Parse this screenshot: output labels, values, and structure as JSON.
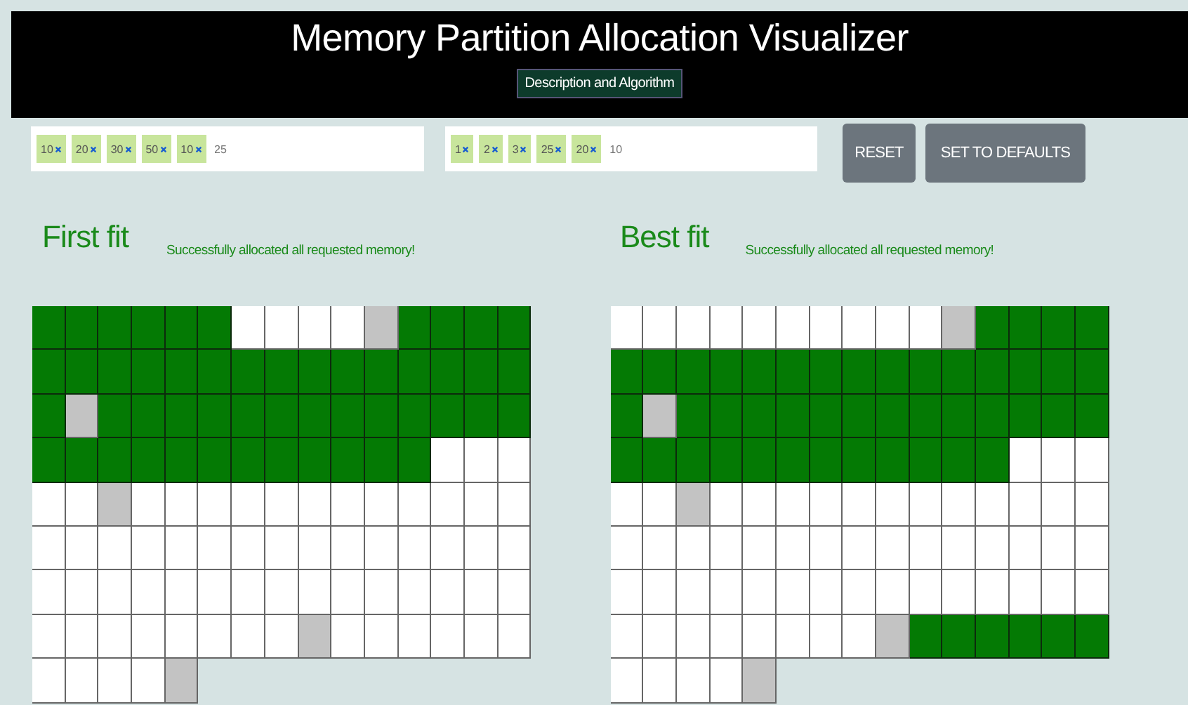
{
  "header": {
    "title": "Memory Partition Allocation Visualizer",
    "link_button": "Description and Algorithm"
  },
  "inputs": [
    {
      "tags": [
        {
          "label": "10"
        },
        {
          "label": "20"
        },
        {
          "label": "30"
        },
        {
          "label": "50"
        },
        {
          "label": "10"
        }
      ],
      "value": "25"
    },
    {
      "tags": [
        {
          "label": "1"
        },
        {
          "label": "2"
        },
        {
          "label": "3"
        },
        {
          "label": "25"
        },
        {
          "label": "20"
        }
      ],
      "value": "10"
    }
  ],
  "buttons": [
    "RESET",
    "SET TO DEFAULTS"
  ],
  "panels": [
    {
      "title": "First fit",
      "message": "Successfully allocated all requested memory!",
      "grid": [
        [
          {
            "kind": "used"
          },
          {
            "kind": "used"
          },
          {
            "kind": "used"
          },
          {
            "kind": "used"
          },
          {
            "kind": "used"
          },
          {
            "kind": "used"
          },
          {
            "kind": "free"
          },
          {
            "kind": "free"
          },
          {
            "kind": "free"
          },
          {
            "kind": "free"
          },
          {
            "kind": "boundary"
          },
          {
            "kind": "used"
          },
          {
            "kind": "used"
          },
          {
            "kind": "used"
          },
          {
            "kind": "used"
          }
        ],
        [
          {
            "kind": "used"
          },
          {
            "kind": "used"
          },
          {
            "kind": "used"
          },
          {
            "kind": "used"
          },
          {
            "kind": "used"
          },
          {
            "kind": "used"
          },
          {
            "kind": "used"
          },
          {
            "kind": "used"
          },
          {
            "kind": "used"
          },
          {
            "kind": "used"
          },
          {
            "kind": "used"
          },
          {
            "kind": "used"
          },
          {
            "kind": "used"
          },
          {
            "kind": "used"
          },
          {
            "kind": "used"
          }
        ],
        [
          {
            "kind": "used"
          },
          {
            "kind": "boundary"
          },
          {
            "kind": "used"
          },
          {
            "kind": "used"
          },
          {
            "kind": "used"
          },
          {
            "kind": "used"
          },
          {
            "kind": "used"
          },
          {
            "kind": "used"
          },
          {
            "kind": "used"
          },
          {
            "kind": "used"
          },
          {
            "kind": "used"
          },
          {
            "kind": "used"
          },
          {
            "kind": "used"
          },
          {
            "kind": "used"
          },
          {
            "kind": "used"
          }
        ],
        [
          {
            "kind": "used"
          },
          {
            "kind": "used"
          },
          {
            "kind": "used"
          },
          {
            "kind": "used"
          },
          {
            "kind": "used"
          },
          {
            "kind": "used"
          },
          {
            "kind": "used"
          },
          {
            "kind": "used"
          },
          {
            "kind": "used"
          },
          {
            "kind": "used"
          },
          {
            "kind": "used"
          },
          {
            "kind": "used"
          },
          {
            "kind": "free"
          },
          {
            "kind": "free"
          },
          {
            "kind": "free"
          }
        ],
        [
          {
            "kind": "free"
          },
          {
            "kind": "free"
          },
          {
            "kind": "boundary"
          },
          {
            "kind": "free"
          },
          {
            "kind": "free"
          },
          {
            "kind": "free"
          },
          {
            "kind": "free"
          },
          {
            "kind": "free"
          },
          {
            "kind": "free"
          },
          {
            "kind": "free"
          },
          {
            "kind": "free"
          },
          {
            "kind": "free"
          },
          {
            "kind": "free"
          },
          {
            "kind": "free"
          },
          {
            "kind": "free"
          }
        ],
        [
          {
            "kind": "free"
          },
          {
            "kind": "free"
          },
          {
            "kind": "free"
          },
          {
            "kind": "free"
          },
          {
            "kind": "free"
          },
          {
            "kind": "free"
          },
          {
            "kind": "free"
          },
          {
            "kind": "free"
          },
          {
            "kind": "free"
          },
          {
            "kind": "free"
          },
          {
            "kind": "free"
          },
          {
            "kind": "free"
          },
          {
            "kind": "free"
          },
          {
            "kind": "free"
          },
          {
            "kind": "free"
          }
        ],
        [
          {
            "kind": "free"
          },
          {
            "kind": "free"
          },
          {
            "kind": "free"
          },
          {
            "kind": "free"
          },
          {
            "kind": "free"
          },
          {
            "kind": "free"
          },
          {
            "kind": "free"
          },
          {
            "kind": "free"
          },
          {
            "kind": "free"
          },
          {
            "kind": "free"
          },
          {
            "kind": "free"
          },
          {
            "kind": "free"
          },
          {
            "kind": "free"
          },
          {
            "kind": "free"
          },
          {
            "kind": "free"
          }
        ],
        [
          {
            "kind": "free"
          },
          {
            "kind": "free"
          },
          {
            "kind": "free"
          },
          {
            "kind": "free"
          },
          {
            "kind": "free"
          },
          {
            "kind": "free"
          },
          {
            "kind": "free"
          },
          {
            "kind": "free"
          },
          {
            "kind": "boundary"
          },
          {
            "kind": "free"
          },
          {
            "kind": "free"
          },
          {
            "kind": "free"
          },
          {
            "kind": "free"
          },
          {
            "kind": "free"
          },
          {
            "kind": "free"
          }
        ],
        [
          {
            "kind": "free"
          },
          {
            "kind": "free"
          },
          {
            "kind": "free"
          },
          {
            "kind": "free"
          },
          {
            "kind": "boundary"
          }
        ]
      ]
    },
    {
      "title": "Best fit",
      "message": "Successfully allocated all requested memory!",
      "grid": [
        [
          {
            "kind": "free"
          },
          {
            "kind": "free"
          },
          {
            "kind": "free"
          },
          {
            "kind": "free"
          },
          {
            "kind": "free"
          },
          {
            "kind": "free"
          },
          {
            "kind": "free"
          },
          {
            "kind": "free"
          },
          {
            "kind": "free"
          },
          {
            "kind": "free"
          },
          {
            "kind": "boundary"
          },
          {
            "kind": "used"
          },
          {
            "kind": "used"
          },
          {
            "kind": "used"
          },
          {
            "kind": "used"
          }
        ],
        [
          {
            "kind": "used"
          },
          {
            "kind": "used"
          },
          {
            "kind": "used"
          },
          {
            "kind": "used"
          },
          {
            "kind": "used"
          },
          {
            "kind": "used"
          },
          {
            "kind": "used"
          },
          {
            "kind": "used"
          },
          {
            "kind": "used"
          },
          {
            "kind": "used"
          },
          {
            "kind": "used"
          },
          {
            "kind": "used"
          },
          {
            "kind": "used"
          },
          {
            "kind": "used"
          },
          {
            "kind": "used"
          }
        ],
        [
          {
            "kind": "used"
          },
          {
            "kind": "boundary"
          },
          {
            "kind": "used"
          },
          {
            "kind": "used"
          },
          {
            "kind": "used"
          },
          {
            "kind": "used"
          },
          {
            "kind": "used"
          },
          {
            "kind": "used"
          },
          {
            "kind": "used"
          },
          {
            "kind": "used"
          },
          {
            "kind": "used"
          },
          {
            "kind": "used"
          },
          {
            "kind": "used"
          },
          {
            "kind": "used"
          },
          {
            "kind": "used"
          }
        ],
        [
          {
            "kind": "used"
          },
          {
            "kind": "used"
          },
          {
            "kind": "used"
          },
          {
            "kind": "used"
          },
          {
            "kind": "used"
          },
          {
            "kind": "used"
          },
          {
            "kind": "used"
          },
          {
            "kind": "used"
          },
          {
            "kind": "used"
          },
          {
            "kind": "used"
          },
          {
            "kind": "used"
          },
          {
            "kind": "used"
          },
          {
            "kind": "free"
          },
          {
            "kind": "free"
          },
          {
            "kind": "free"
          }
        ],
        [
          {
            "kind": "free"
          },
          {
            "kind": "free"
          },
          {
            "kind": "boundary"
          },
          {
            "kind": "free"
          },
          {
            "kind": "free"
          },
          {
            "kind": "free"
          },
          {
            "kind": "free"
          },
          {
            "kind": "free"
          },
          {
            "kind": "free"
          },
          {
            "kind": "free"
          },
          {
            "kind": "free"
          },
          {
            "kind": "free"
          },
          {
            "kind": "free"
          },
          {
            "kind": "free"
          },
          {
            "kind": "free"
          }
        ],
        [
          {
            "kind": "free"
          },
          {
            "kind": "free"
          },
          {
            "kind": "free"
          },
          {
            "kind": "free"
          },
          {
            "kind": "free"
          },
          {
            "kind": "free"
          },
          {
            "kind": "free"
          },
          {
            "kind": "free"
          },
          {
            "kind": "free"
          },
          {
            "kind": "free"
          },
          {
            "kind": "free"
          },
          {
            "kind": "free"
          },
          {
            "kind": "free"
          },
          {
            "kind": "free"
          },
          {
            "kind": "free"
          }
        ],
        [
          {
            "kind": "free"
          },
          {
            "kind": "free"
          },
          {
            "kind": "free"
          },
          {
            "kind": "free"
          },
          {
            "kind": "free"
          },
          {
            "kind": "free"
          },
          {
            "kind": "free"
          },
          {
            "kind": "free"
          },
          {
            "kind": "free"
          },
          {
            "kind": "free"
          },
          {
            "kind": "free"
          },
          {
            "kind": "free"
          },
          {
            "kind": "free"
          },
          {
            "kind": "free"
          },
          {
            "kind": "free"
          }
        ],
        [
          {
            "kind": "free"
          },
          {
            "kind": "free"
          },
          {
            "kind": "free"
          },
          {
            "kind": "free"
          },
          {
            "kind": "free"
          },
          {
            "kind": "free"
          },
          {
            "kind": "free"
          },
          {
            "kind": "free"
          },
          {
            "kind": "boundary"
          },
          {
            "kind": "used"
          },
          {
            "kind": "used"
          },
          {
            "kind": "used"
          },
          {
            "kind": "used"
          },
          {
            "kind": "used"
          },
          {
            "kind": "used"
          }
        ],
        [
          {
            "kind": "free"
          },
          {
            "kind": "free"
          },
          {
            "kind": "free"
          },
          {
            "kind": "free"
          },
          {
            "kind": "boundary"
          }
        ]
      ]
    }
  ]
}
